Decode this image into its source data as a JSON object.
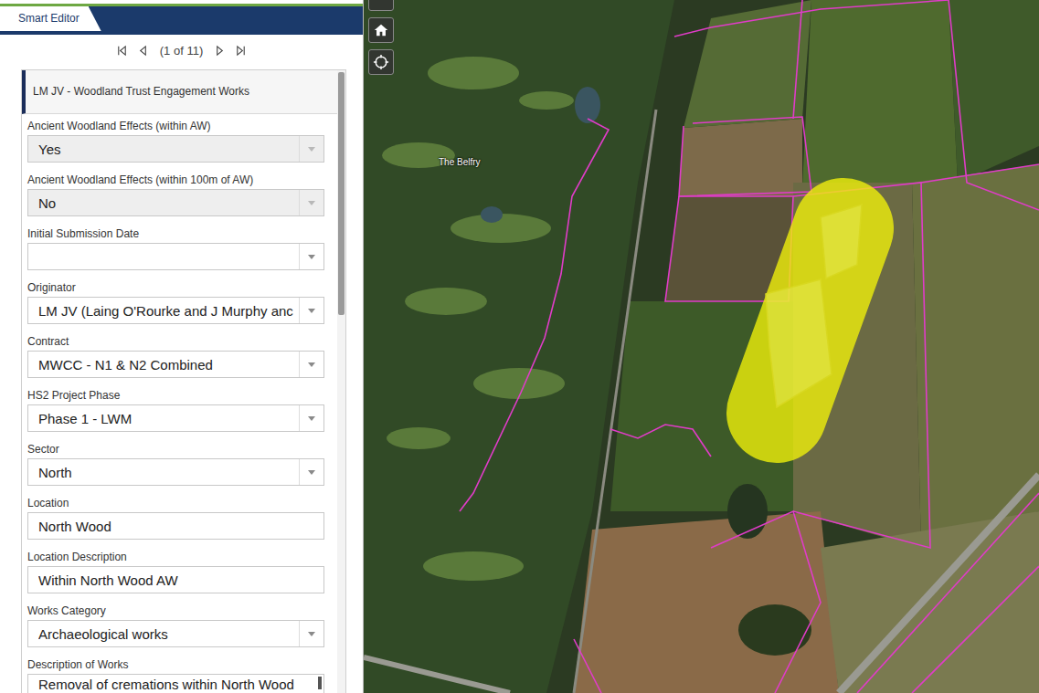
{
  "editor": {
    "title": "Smart Editor"
  },
  "pager": {
    "status": "(1 of 11)"
  },
  "record": {
    "title": "LM JV - Woodland Trust Engagement Works"
  },
  "fields": [
    {
      "label": "Ancient Woodland Effects (within AW)",
      "value": "Yes",
      "kind": "select",
      "disabled": true
    },
    {
      "label": "Ancient Woodland Effects (within 100m of AW)",
      "value": "No",
      "kind": "select",
      "disabled": true
    },
    {
      "label": "Initial Submission Date",
      "value": "",
      "kind": "select",
      "disabled": false
    },
    {
      "label": "Originator",
      "value": "LM JV (Laing O'Rourke and J Murphy anc",
      "kind": "select",
      "disabled": false
    },
    {
      "label": "Contract",
      "value": "MWCC - N1 & N2 Combined",
      "kind": "select",
      "disabled": false
    },
    {
      "label": "HS2 Project Phase",
      "value": "Phase 1 - LWM",
      "kind": "select",
      "disabled": false
    },
    {
      "label": "Sector",
      "value": "North",
      "kind": "select",
      "disabled": false
    },
    {
      "label": "Location",
      "value": "North Wood",
      "kind": "text",
      "disabled": false
    },
    {
      "label": "Location Description",
      "value": "Within North Wood AW",
      "kind": "text",
      "disabled": false
    },
    {
      "label": "Works Category",
      "value": "Archaeological works",
      "kind": "select",
      "disabled": false
    },
    {
      "label": "Description of Works",
      "value": "Removal of cremations within North Wood",
      "kind": "textarea",
      "disabled": false
    }
  ],
  "map": {
    "labels": [
      {
        "text": "The Belfry"
      }
    ]
  }
}
